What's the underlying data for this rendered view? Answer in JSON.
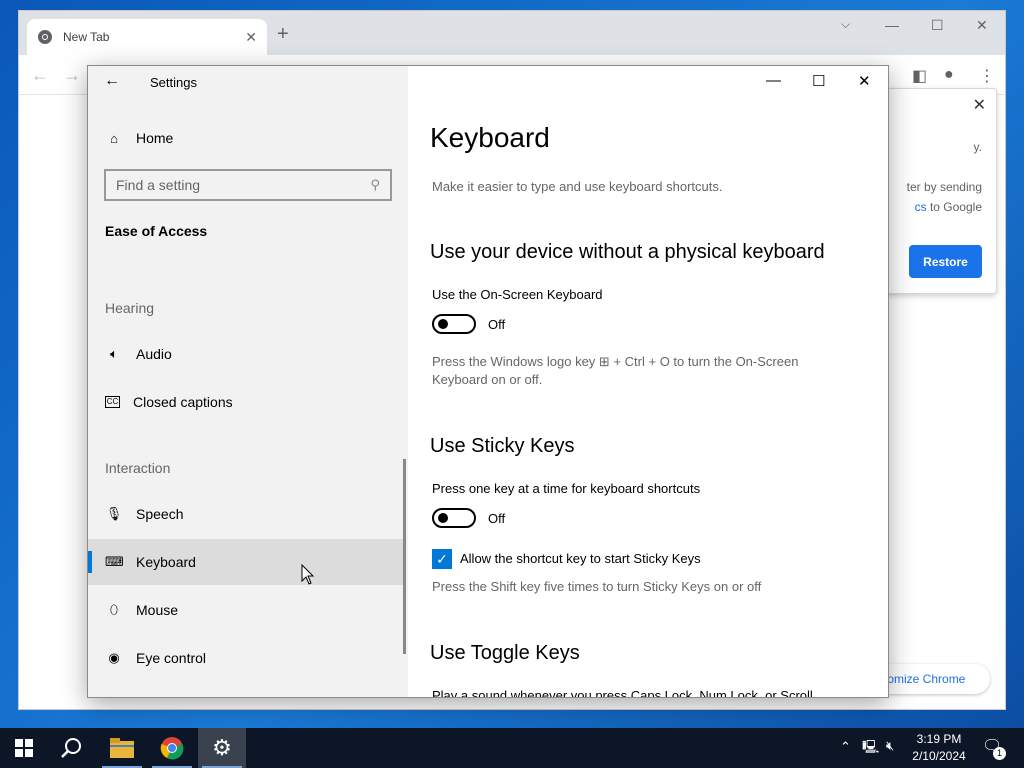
{
  "chrome": {
    "tab_title": "New Tab",
    "tab_close": "✕",
    "new_tab": "+",
    "restore_popup": {
      "line1": "y.",
      "line2": "ter by sending",
      "line3_link": "cs",
      "line3_rest": " to Google",
      "restore_label": "Restore"
    },
    "customize_label": "tomize Chrome"
  },
  "settings": {
    "window_title": "Settings",
    "nav": {
      "home": "Home",
      "search_placeholder": "Find a setting",
      "category": "Ease of Access",
      "section_hearing": "Hearing",
      "audio": "Audio",
      "closed_captions": "Closed captions",
      "section_interaction": "Interaction",
      "speech": "Speech",
      "keyboard": "Keyboard",
      "mouse": "Mouse",
      "eye_control": "Eye control"
    },
    "main": {
      "title": "Keyboard",
      "subtitle": "Make it easier to type and use keyboard shortcuts.",
      "section1_title": "Use your device without a physical keyboard",
      "onscreen_label": "Use the On-Screen Keyboard",
      "onscreen_state": "Off",
      "onscreen_help_1": "Press the Windows logo key",
      "onscreen_help_2": "+ Ctrl + O to turn the On-Screen Keyboard on or off.",
      "section2_title": "Use Sticky Keys",
      "sticky_label": "Press one key at a time for keyboard shortcuts",
      "sticky_state": "Off",
      "sticky_shortcut_label": "Allow the shortcut key to start Sticky Keys",
      "sticky_help": "Press the Shift key five times to turn Sticky Keys on or off",
      "section3_title": "Use Toggle Keys",
      "toggle_keys_cut": "Play a sound whenever you press Caps Lock, Num Lock, or Scroll"
    }
  },
  "taskbar": {
    "time": "3:19 PM",
    "date": "2/10/2024",
    "notification_count": "1"
  },
  "colors": {
    "accent": "#0078d7",
    "chrome_blue": "#1a73e8",
    "taskbar": "#0d1626"
  }
}
